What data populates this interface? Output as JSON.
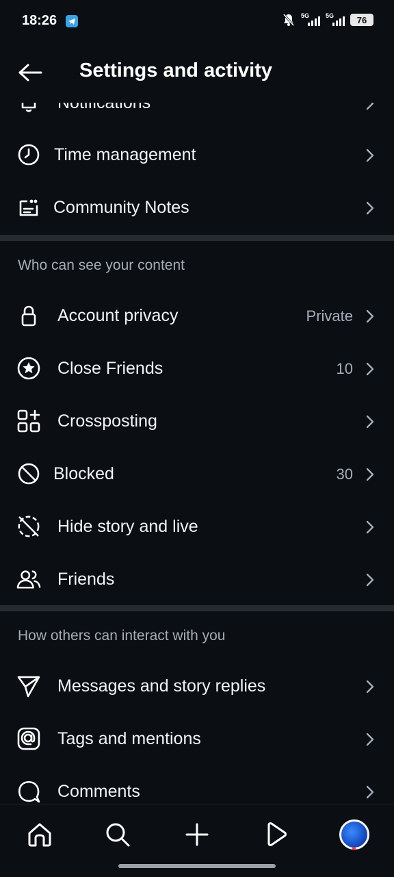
{
  "status_bar": {
    "time": "18:26",
    "network_1": "5G",
    "network_2": "5G",
    "battery": "76"
  },
  "header": {
    "title": "Settings and activity"
  },
  "rows_top": [
    {
      "label": "Notifications",
      "icon": "bell-icon"
    },
    {
      "label": "Time management",
      "icon": "clock-icon"
    },
    {
      "label": "Community Notes",
      "icon": "community-notes-icon"
    }
  ],
  "section_content": {
    "title": "Who can see your content",
    "items": [
      {
        "label": "Account privacy",
        "value": "Private",
        "icon": "lock-icon"
      },
      {
        "label": "Close Friends",
        "value": "10",
        "icon": "star-circle-icon"
      },
      {
        "label": "Crossposting",
        "value": "",
        "icon": "crosspost-grid-icon"
      },
      {
        "label": "Blocked",
        "value": "30",
        "icon": "blocked-icon"
      },
      {
        "label": "Hide story and live",
        "value": "",
        "icon": "hide-story-icon"
      },
      {
        "label": "Friends",
        "value": "",
        "icon": "friends-icon"
      }
    ]
  },
  "section_interact": {
    "title": "How others can interact with you",
    "items": [
      {
        "label": "Messages and story replies",
        "icon": "messages-icon"
      },
      {
        "label": "Tags and mentions",
        "icon": "at-icon"
      },
      {
        "label": "Comments",
        "icon": "comment-icon"
      }
    ]
  },
  "bottom_nav": [
    "home-icon",
    "search-icon",
    "create-icon",
    "reels-icon",
    "profile-avatar"
  ],
  "colors": {
    "background": "#0b0f14",
    "divider": "#262b31",
    "secondary_text": "#a6adb6",
    "notification_dot": "#ff3040"
  }
}
